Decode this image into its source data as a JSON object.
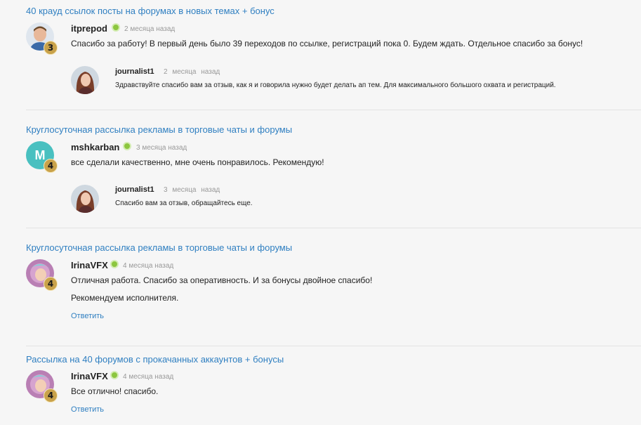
{
  "reviews": [
    {
      "title": "40 крауд ссылок посты на форумах в новых темах + бонус",
      "author": "itprepod",
      "level": "3",
      "time": "2 месяца назад",
      "text": "Спасибо за работу! В первый день было 39 переходов по ссылке, регистраций пока 0. Будем ждать. Отдельное спасибо за бонус!",
      "reply": {
        "author": "journalist1",
        "time": "2 месяца назад",
        "text": "Здравствуйте спасибо вам за отзыв, как я и говорила нужно будет делать ап тем. Для максимального большого охвата и регистраций."
      }
    },
    {
      "title": "Круглосуточная рассылка рекламы в торговые чаты и форумы",
      "author": "mshkarban",
      "avatar_initial": "M",
      "level": "4",
      "time": "3 месяца назад",
      "text": "все сделали качественно, мне очень понравилось. Рекомендую!",
      "reply": {
        "author": "journalist1",
        "time": "3 месяца назад",
        "text": "Спасибо вам за отзыв, обращайтесь еще."
      }
    },
    {
      "title": "Круглосуточная рассылка рекламы в торговые чаты и форумы",
      "author": "IrinaVFX",
      "level": "4",
      "time": "4 месяца назад",
      "text": "Отличная работа. Спасибо за оперативность. И за бонусы двойное спасибо!",
      "text2": "Рекомендуем исполнителя.",
      "answer_label": "Ответить"
    },
    {
      "title": "Рассылка на 40 форумов с прокачанных аккаунтов + бонусы",
      "author": "IrinaVFX",
      "level": "4",
      "time": "4 месяца назад",
      "text": "Все отлично! спасибо.",
      "answer_label": "Ответить"
    }
  ]
}
